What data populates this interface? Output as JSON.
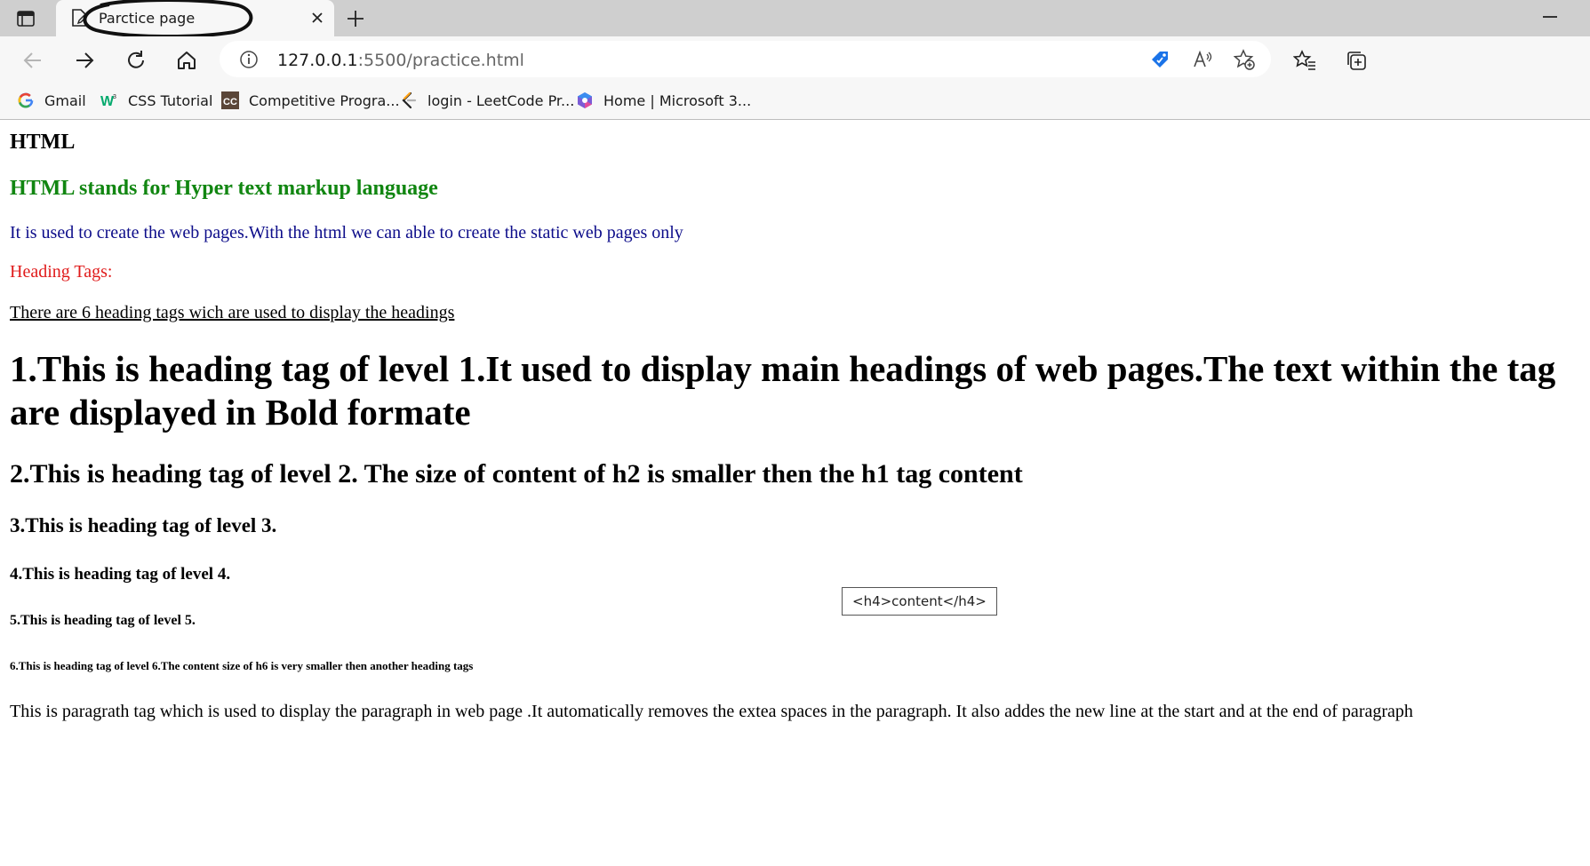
{
  "browser": {
    "tab": {
      "title": "Parctice page"
    },
    "address_bar": {
      "url_host": "127.0.0.1",
      "url_rest": ":5500/practice.html"
    },
    "bookmarks": [
      {
        "label": "Gmail",
        "icon": "google-icon"
      },
      {
        "label": "CSS Tutorial",
        "icon": "w3schools-icon"
      },
      {
        "label": "Competitive Progra...",
        "icon": "cc-icon"
      },
      {
        "label": "login - LeetCode Pr...",
        "icon": "leetcode-icon"
      },
      {
        "label": "Home | Microsoft 3...",
        "icon": "microsoft365-icon"
      }
    ]
  },
  "page": {
    "title_heading": "HTML",
    "subtitle_heading": "HTML stands for Hyper text markup language",
    "intro_paragraph": "It is used to create the web pages.With the html we can able to create the static web pages only",
    "section_label": "Heading Tags:",
    "section_note": "There are 6 heading tags wich are used to display the headings",
    "h1": "1.This is heading tag of level 1.It used to display main headings of web pages.The text within the tag are displayed in Bold formate",
    "h2": "2.This is heading tag of level 2. The size of content of h2 is smaller then the h1 tag content",
    "h3": "3.This is heading tag of level 3.",
    "h4": "4.This is heading tag of level 4.",
    "h5": "5.This is heading tag of level 5.",
    "h6": "6.This is heading tag of level 6.The content size of h6 is very smaller then another heading tags",
    "paragraph": "This is paragrath tag which is used to display the paragraph in web page .It automatically removes the extea spaces in the paragraph. It also addes the new line at the start and at the end of paragraph",
    "tooltip": "<h4>content</h4>"
  },
  "colors": {
    "green_heading": "#118611",
    "blue_text": "#0d0d8a",
    "red_text": "#e01b1b"
  }
}
